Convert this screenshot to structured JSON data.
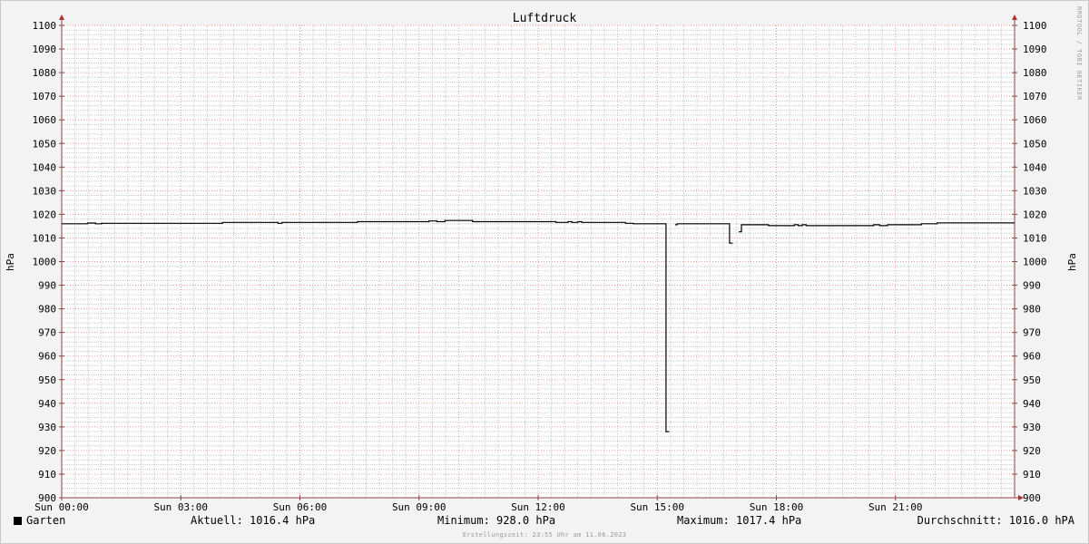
{
  "chart_data": {
    "type": "line",
    "title": "Luftdruck",
    "ylabel": "hPa",
    "ylabel_right": "hPa",
    "ylim": [
      900,
      1100
    ],
    "yticks": [
      900,
      910,
      920,
      930,
      940,
      950,
      960,
      970,
      980,
      990,
      1000,
      1010,
      1020,
      1030,
      1040,
      1050,
      1060,
      1070,
      1080,
      1090,
      1100
    ],
    "xlim": [
      0,
      24
    ],
    "xticks": [
      {
        "x": 0,
        "label": "Sun 00:00"
      },
      {
        "x": 3,
        "label": "Sun 03:00"
      },
      {
        "x": 6,
        "label": "Sun 06:00"
      },
      {
        "x": 9,
        "label": "Sun 09:00"
      },
      {
        "x": 12,
        "label": "Sun 12:00"
      },
      {
        "x": 15,
        "label": "Sun 15:00"
      },
      {
        "x": 18,
        "label": "Sun 18:00"
      },
      {
        "x": 21,
        "label": "Sun 21:00"
      }
    ],
    "grid": true,
    "series": [
      {
        "name": "Garten",
        "color": "#000000",
        "segments": [
          [
            [
              0,
              1016.0
            ],
            [
              0.6,
              1016.0
            ],
            [
              0.65,
              1016.3
            ],
            [
              0.8,
              1016.3
            ],
            [
              0.85,
              1016.0
            ],
            [
              1.0,
              1016.2
            ],
            [
              4.0,
              1016.2
            ],
            [
              4.05,
              1016.6
            ],
            [
              5.4,
              1016.6
            ],
            [
              5.45,
              1016.2
            ],
            [
              5.55,
              1016.6
            ],
            [
              7.4,
              1016.6
            ],
            [
              7.45,
              1016.9
            ],
            [
              9.2,
              1016.9
            ],
            [
              9.25,
              1017.2
            ],
            [
              9.4,
              1017.2
            ],
            [
              9.45,
              1016.9
            ],
            [
              9.6,
              1016.9
            ],
            [
              9.65,
              1017.4
            ],
            [
              10.3,
              1017.4
            ],
            [
              10.35,
              1016.9
            ],
            [
              12.4,
              1016.9
            ],
            [
              12.45,
              1016.6
            ],
            [
              12.7,
              1016.6
            ],
            [
              12.75,
              1016.9
            ],
            [
              12.85,
              1016.6
            ],
            [
              13.0,
              1016.9
            ],
            [
              13.1,
              1016.6
            ],
            [
              14.15,
              1016.6
            ],
            [
              14.2,
              1016.2
            ],
            [
              14.35,
              1016.2
            ],
            [
              14.4,
              1016.0
            ],
            [
              15.2,
              1016.0
            ],
            [
              15.22,
              928.0
            ],
            [
              15.3,
              928.0
            ]
          ],
          [
            [
              15.45,
              1015.6
            ],
            [
              15.5,
              1016.0
            ],
            [
              16.8,
              1016.0
            ],
            [
              16.82,
              1007.8
            ],
            [
              16.9,
              1007.8
            ]
          ],
          [
            [
              17.05,
              1012.6
            ],
            [
              17.1,
              1012.6
            ],
            [
              17.12,
              1015.6
            ],
            [
              17.75,
              1015.6
            ],
            [
              17.8,
              1015.2
            ],
            [
              18.4,
              1015.2
            ],
            [
              18.45,
              1015.6
            ],
            [
              18.55,
              1015.2
            ],
            [
              18.65,
              1015.6
            ],
            [
              18.75,
              1015.2
            ],
            [
              20.4,
              1015.2
            ],
            [
              20.45,
              1015.6
            ],
            [
              20.6,
              1015.2
            ],
            [
              20.8,
              1015.6
            ],
            [
              21.6,
              1015.6
            ],
            [
              21.65,
              1016.0
            ],
            [
              22.0,
              1016.0
            ],
            [
              22.05,
              1016.4
            ],
            [
              24.0,
              1016.4
            ]
          ]
        ]
      }
    ]
  },
  "legend": {
    "series_name": "Garten",
    "current": "Aktuell: 1016.4 hPa",
    "minimum": "Minimum: 928.0 hPa",
    "maximum": "Maximum: 1017.4 hPa",
    "average": "Durchschnitt: 1016.0 hPA"
  },
  "footer": "Erstellungszeit: 23:55 Uhr am 11.06.2023",
  "watermark": "RRDTOOL / TOBI OETIKER",
  "colors": {
    "background": "#f3f3f3",
    "plot_background": "#ffffff",
    "major_grid": "#e89a9a",
    "minor_grid": "#cccccc",
    "axis": "#8a4646",
    "line": "#000000"
  }
}
